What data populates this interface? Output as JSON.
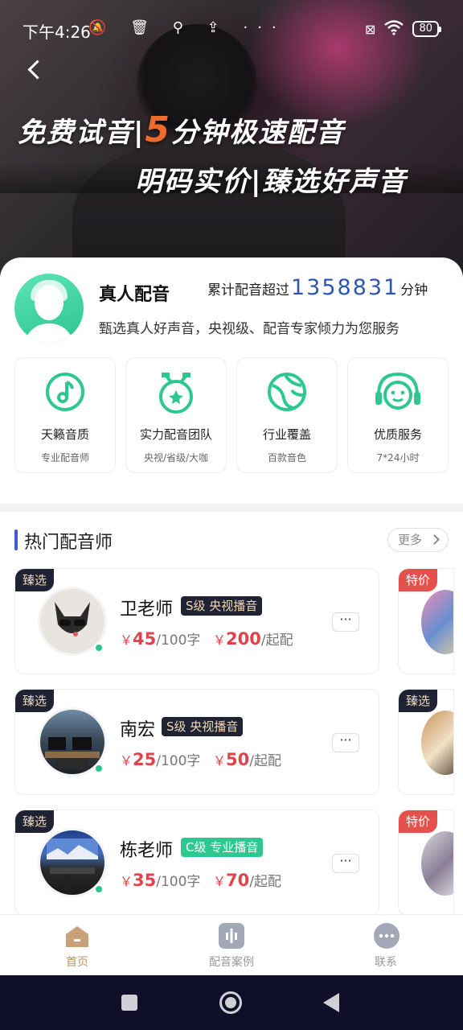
{
  "status_bar": {
    "time": "下午4:26",
    "left_icons": [
      "mute-icon",
      "trash-icon",
      "location-icon",
      "upload-icon",
      "more-icon"
    ],
    "battery": "80"
  },
  "hero": {
    "slogan_part1": "免费试音|",
    "slogan_highlight": "5",
    "slogan_part2": "分钟极速配音",
    "slogan_line2": "明码实价|臻选好声音"
  },
  "intro": {
    "title": "真人配音",
    "count_prefix": "累计配音超过",
    "count_value": "1358831",
    "count_suffix": "分钟",
    "description": "甄选真人好声音，央视级、配音专家倾力为您服务"
  },
  "features": [
    {
      "title": "天籁音质",
      "subtitle": "专业配音师",
      "icon": "music-note-icon"
    },
    {
      "title": "实力配音团队",
      "subtitle": "央视/省级/大咖",
      "icon": "medal-icon"
    },
    {
      "title": "行业覆盖",
      "subtitle": "百款音色",
      "icon": "globe-icon"
    },
    {
      "title": "优质服务",
      "subtitle": "7*24小时",
      "icon": "headset-icon"
    }
  ],
  "hot_section": {
    "title": "热门配音师",
    "more_label": "更多",
    "cards": [
      {
        "tag": "臻选",
        "name": "卫老师",
        "level": "S级 央视播音",
        "price_per": "45",
        "per_unit": "/100字",
        "price_min": "200",
        "min_unit": "/起配",
        "more": "···"
      },
      {
        "tag": "臻选",
        "name": "南宏",
        "level": "S级 央视播音",
        "price_per": "25",
        "per_unit": "/100字",
        "price_min": "50",
        "min_unit": "/起配",
        "more": "···"
      },
      {
        "tag": "臻选",
        "name": "栋老师",
        "level": "C级 专业播音",
        "price_per": "35",
        "per_unit": "/100字",
        "price_min": "70",
        "min_unit": "/起配",
        "more": "···"
      }
    ],
    "peek_tags": [
      "特价",
      "臻选",
      "特价"
    ],
    "currency": "￥"
  },
  "tabbar": [
    {
      "label": "首页",
      "icon": "home-icon",
      "active": true
    },
    {
      "label": "配音案例",
      "icon": "audio-wave-icon",
      "active": false
    },
    {
      "label": "联系",
      "icon": "chat-icon",
      "active": false
    }
  ],
  "colors": {
    "accent_blue": "#3a5ed1",
    "price_red": "#e0434a",
    "green": "#2ec78f",
    "dark_tag": "#1e2233",
    "active_tab": "#b8956a"
  }
}
